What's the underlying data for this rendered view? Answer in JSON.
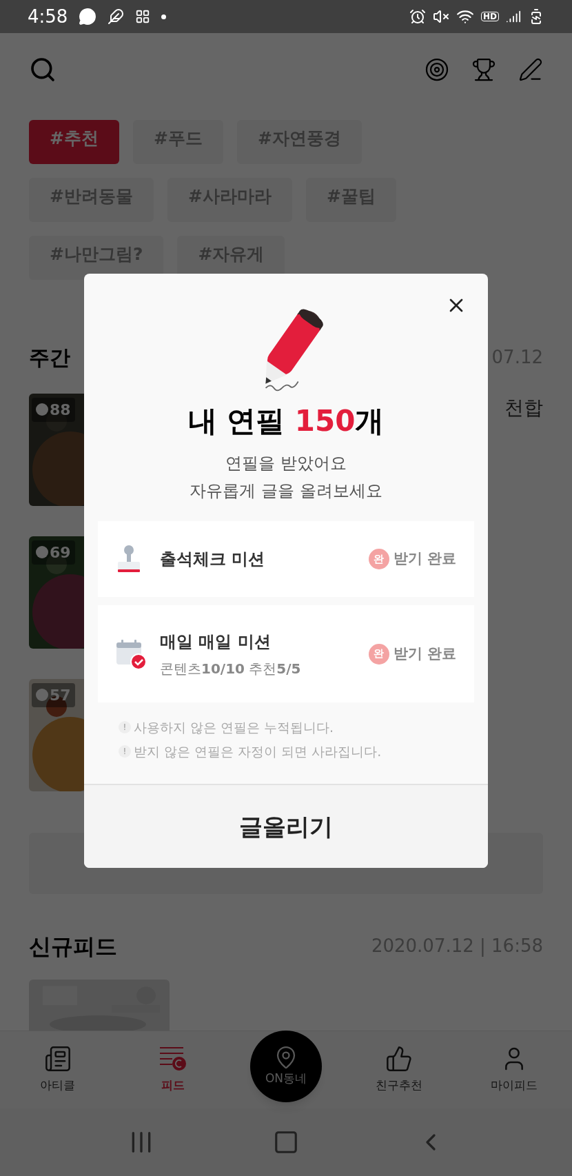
{
  "status_bar": {
    "time": "4:58",
    "hd": "HD"
  },
  "tags": [
    {
      "label": "#추천",
      "selected": true
    },
    {
      "label": "#푸드",
      "selected": false
    },
    {
      "label": "#자연풍경",
      "selected": false
    },
    {
      "label": "#반려동물",
      "selected": false
    },
    {
      "label": "#사라마라",
      "selected": false
    },
    {
      "label": "#꿀팁",
      "selected": false
    },
    {
      "label": "#나만그림?",
      "selected": false
    },
    {
      "label": "#자유게",
      "selected": false
    }
  ],
  "weekly": {
    "title": "주간",
    "date": "07.12",
    "snippet": "천합",
    "cards": [
      {
        "count": "88"
      },
      {
        "count": "69"
      },
      {
        "count": "57"
      }
    ]
  },
  "new_feed": {
    "title": "신규피드",
    "date": "2020.07.12 | 16:58"
  },
  "modal": {
    "title_prefix": "내 연필 ",
    "count": "150",
    "title_suffix": "개",
    "subtitle": [
      "연필을 받았어요",
      "자유롭게 글을 올려보세요"
    ],
    "missions": [
      {
        "kind": "stamp",
        "title": "출석체크 미션",
        "badge": "완",
        "status": "받기 완료"
      },
      {
        "kind": "calendar",
        "title": "매일 매일 미션",
        "progress": "콘텐츠**10/10**  추천**5/5**",
        "badge": "완",
        "status": "받기 완료"
      }
    ],
    "notes": [
      {
        "mark": "!",
        "text": "사용하지 않은 연필은 누적됩니다."
      },
      {
        "mark": "!",
        "text": "받지 않은 연필은 자정이 되면 사라집니다."
      }
    ],
    "button": "글올리기"
  },
  "bottom_nav": [
    {
      "kind": "tab",
      "label": "아티클",
      "selected": false
    },
    {
      "kind": "tab",
      "label": "피드",
      "selected": true
    },
    {
      "kind": "center",
      "label": "ON동네",
      "selected": false
    },
    {
      "kind": "tab",
      "label": "친구추천",
      "selected": false
    },
    {
      "kind": "tab",
      "label": "마이피드",
      "selected": false
    }
  ]
}
